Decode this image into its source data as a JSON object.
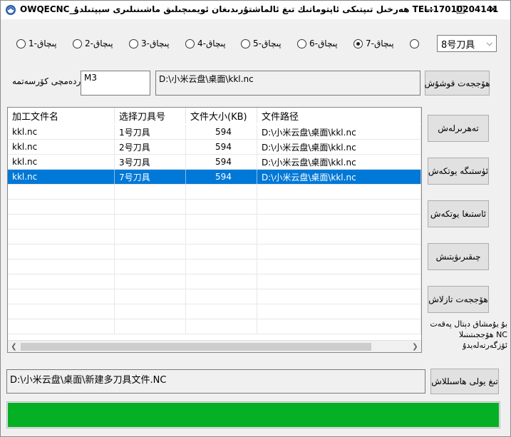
{
  "window": {
    "title": "OWQECNC_ھەرخىل تىپتىكى ئاپتوماتىك تىغ ئالماشتۇرىدىغان ئويمىچىلىق ماشىنىلىرى سېپتىلدۇ TEL:17010204141",
    "minimize": "—",
    "maximize": "☐",
    "close": "✕"
  },
  "radios": [
    {
      "label": "پىچاق-1",
      "checked": false
    },
    {
      "label": "پىچاق-2",
      "checked": false
    },
    {
      "label": "پىچاق-3",
      "checked": false
    },
    {
      "label": "پىچاق-4",
      "checked": false
    },
    {
      "label": "پىچاق-5",
      "checked": false
    },
    {
      "label": "پىچاق-6",
      "checked": false
    },
    {
      "label": "پىچاق-7",
      "checked": true
    },
    {
      "label": "",
      "checked": false
    }
  ],
  "tool_select": {
    "value": "8号刀具"
  },
  "helper": {
    "label": "ياردەمچى كۆرسەتمە",
    "value": "M3"
  },
  "file_path_display": "D:\\小米云盘\\桌面\\kkl.nc",
  "add_file_button": "ھۆججەت قوشۇش",
  "table": {
    "headers": [
      "加工文件名",
      "选择刀具号",
      "文件大小(KB)",
      "文件路径"
    ],
    "rows": [
      {
        "name": "kkl.nc",
        "tool": "1号刀具",
        "size": "594",
        "path": "D:\\小米云盘\\桌面\\kkl.nc",
        "selected": false
      },
      {
        "name": "kkl.nc",
        "tool": "2号刀具",
        "size": "594",
        "path": "D:\\小米云盘\\桌面\\kkl.nc",
        "selected": false
      },
      {
        "name": "kkl.nc",
        "tool": "3号刀具",
        "size": "594",
        "path": "D:\\小米云盘\\桌面\\kkl.nc",
        "selected": false
      },
      {
        "name": "kkl.nc",
        "tool": "7号刀具",
        "size": "594",
        "path": "D:\\小米云盘\\桌面\\kkl.nc",
        "selected": true
      }
    ]
  },
  "side_buttons": {
    "sort": "تەھرىرلەش",
    "move_up": "ئۈستىگە يوتكەش",
    "move_down": "ئاستىغا يوتكەش",
    "delete": "چىقىرىۋېتىش",
    "clear": "ھۆججەت تازلاش"
  },
  "note": "بۇ يۇمشاق دېتال پەقەت NC ھۆججىتىنىلا ئۆزگەرتەلەيدۇ",
  "output_path": "D:\\小米云盘\\桌面\\新建多刀具文件.NC",
  "save_path_button": "تىغ يولى ھاسىللاش",
  "progress": {
    "percent": 100,
    "color": "#06b025"
  }
}
